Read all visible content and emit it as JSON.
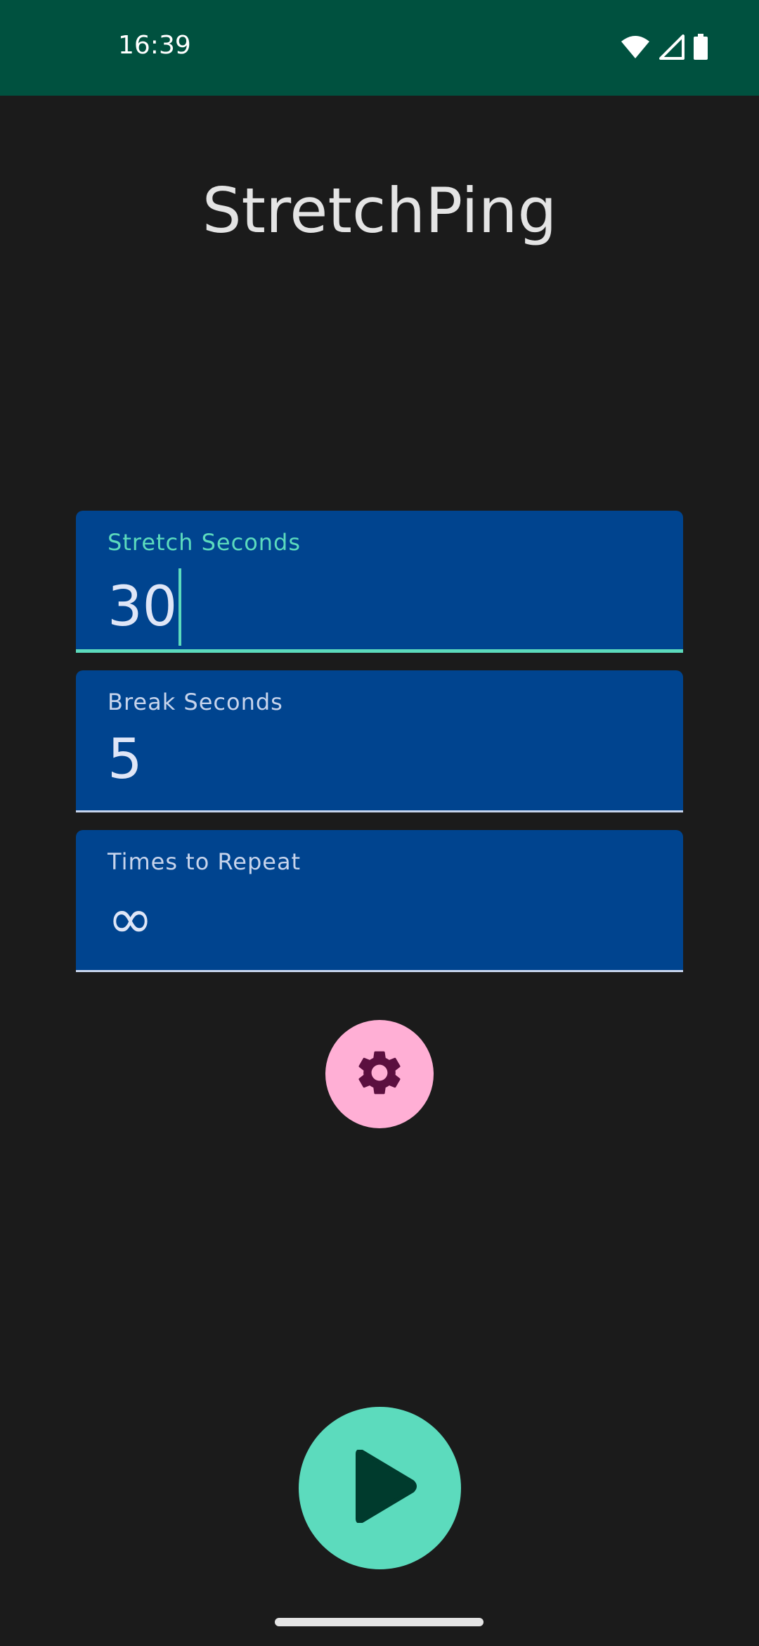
{
  "status_bar": {
    "time": "16:39",
    "icons": [
      "wifi-icon",
      "cellular-signal-icon",
      "battery-icon"
    ]
  },
  "app": {
    "title": "StretchPing"
  },
  "fields": [
    {
      "label": "Stretch Seconds",
      "value": "30",
      "focused": true
    },
    {
      "label": "Break Seconds",
      "value": "5",
      "focused": false
    },
    {
      "label": "Times to Repeat",
      "value": "∞",
      "focused": false
    }
  ],
  "buttons": {
    "settings_icon": "gear-icon",
    "play_icon": "play-icon"
  },
  "colors": {
    "status_bar_bg": "#00513f",
    "background": "#1b1b1b",
    "field_bg": "#00448f",
    "accent": "#5cdbbd",
    "settings_fab_bg": "#ffafd5",
    "settings_icon": "#5b0f3f",
    "play_icon": "#003b2d"
  }
}
